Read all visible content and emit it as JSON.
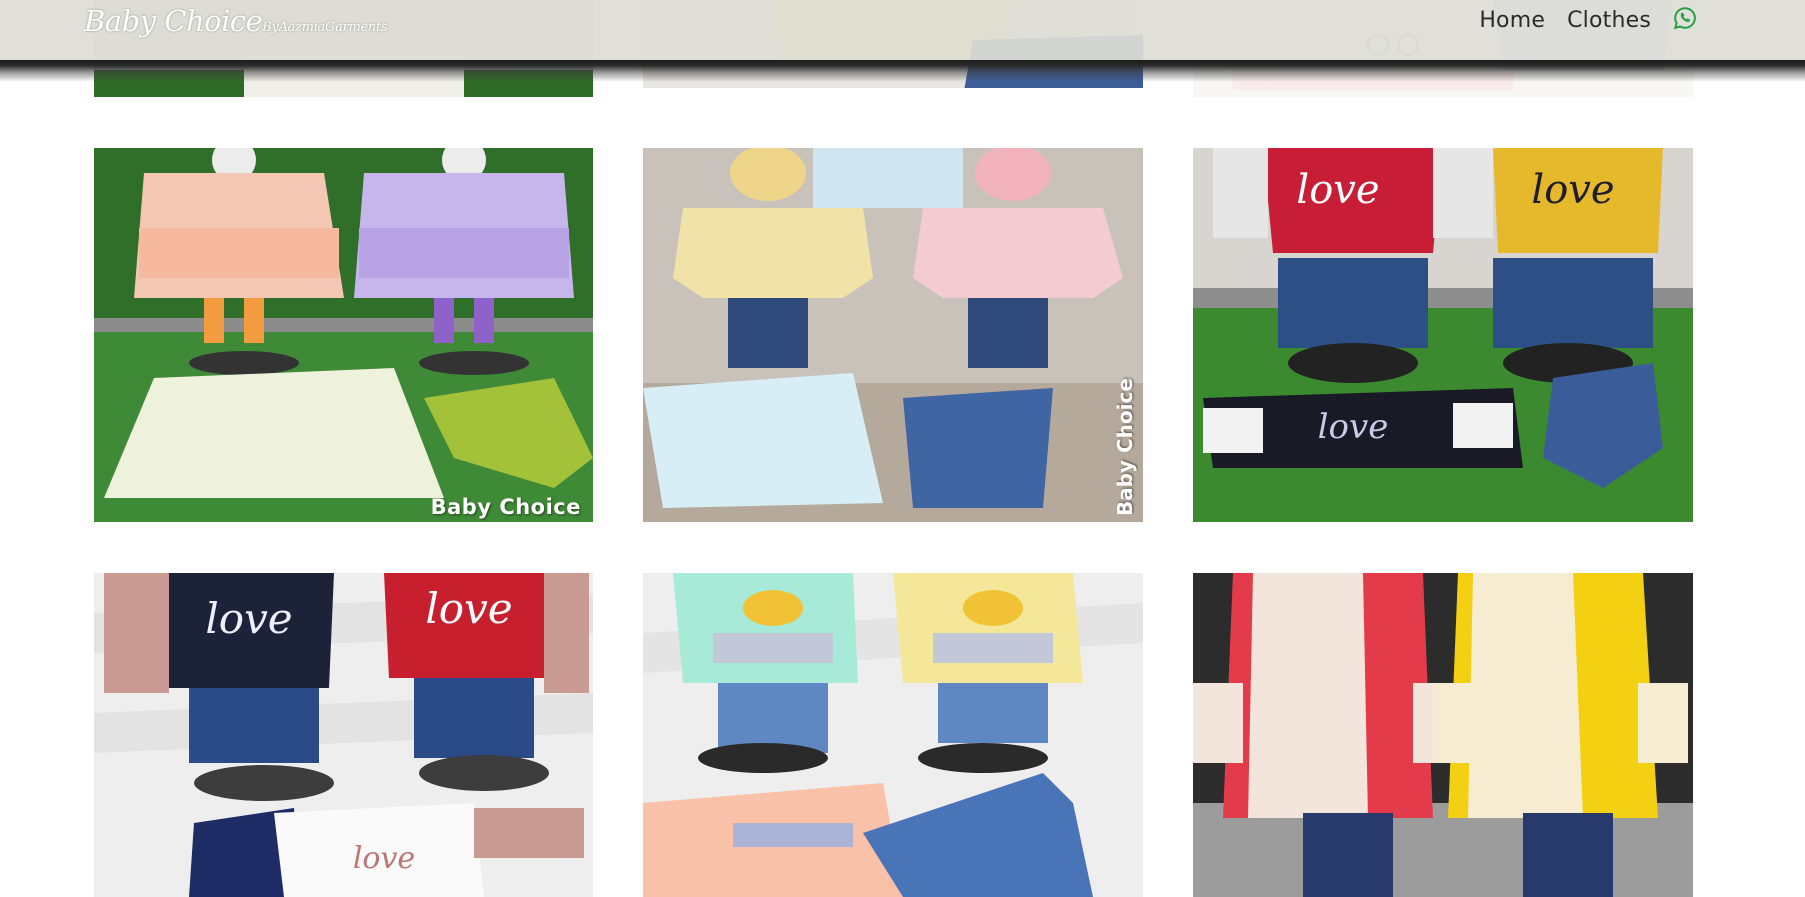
{
  "brand": {
    "name": "Baby Choice",
    "sub": "ByAazmiaGarments"
  },
  "nav": {
    "home": "Home",
    "clothes": "Clothes",
    "whatsapp_icon": "whatsapp-icon"
  },
  "colors": {
    "whatsapp": "#25a244",
    "nav_text": "#2b2b2b"
  },
  "products": {
    "row1": [
      "top-left-garments",
      "top-center-garments",
      "top-right-garments"
    ],
    "row2": [
      {
        "caption": "Baby Choice"
      },
      {
        "caption": "Baby Choice"
      },
      {
        "caption": ""
      }
    ],
    "row3": [
      "love-sets",
      "duck-hoodies",
      "floral-tunics"
    ]
  }
}
